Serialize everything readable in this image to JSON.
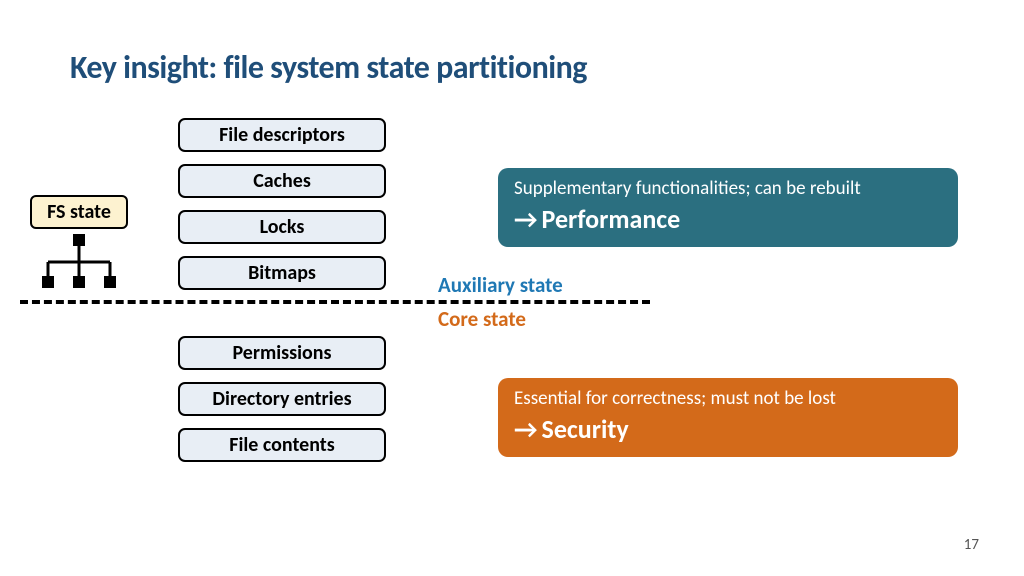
{
  "title": "Key insight: file system state partitioning",
  "fs_state_label": "FS state",
  "state_boxes": {
    "b0": "File descriptors",
    "b1": "Caches",
    "b2": "Locks",
    "b3": "Bitmaps",
    "b4": "Permissions",
    "b5": "Directory entries",
    "b6": "File contents"
  },
  "labels": {
    "auxiliary": "Auxiliary state",
    "core": "Core state"
  },
  "callouts": {
    "perf": {
      "desc": "Supplementary functionalities; can be rebuilt",
      "big": "Performance"
    },
    "sec": {
      "desc": "Essential for correctness; must not be lost",
      "big": "Security"
    }
  },
  "arrow": "→",
  "page_number": "17"
}
